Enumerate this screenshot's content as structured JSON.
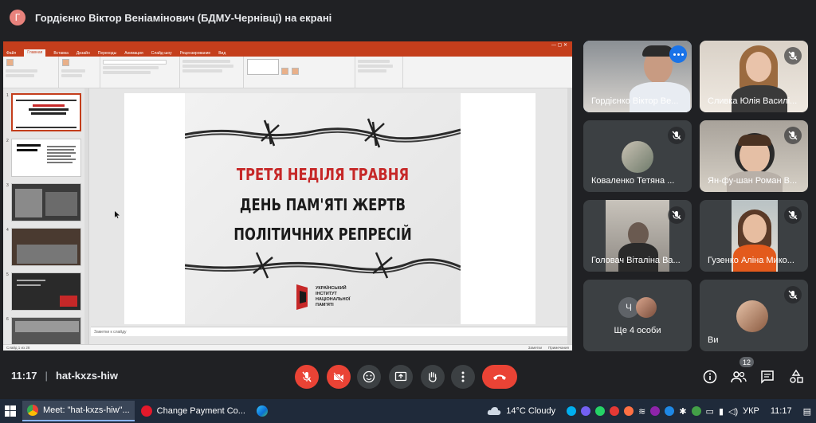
{
  "presenter": {
    "avatar_letter": "Г",
    "title": "Гордієнко Віктор Веніамінович (БДМУ-Чернівці) на екрані"
  },
  "presentation": {
    "ribbon_tabs": [
      "Файл",
      "Главная",
      "Вставка",
      "Дизайн",
      "Переходы",
      "Анимация",
      "Слайд-шоу",
      "Рецензирование",
      "Вид"
    ],
    "slide_lines": [
      "ТРЕТЯ НЕДІЛЯ ТРАВНЯ",
      "ДЕНЬ ПАМ'ЯТІ ЖЕРТВ",
      "ПОЛІТИЧНИХ РЕПРЕСІЙ"
    ],
    "institute_lines": [
      "УКРАЇНСЬКИЙ",
      "ІНСТИТУТ",
      "НАЦІОНАЛЬНОЇ",
      "ПАМ'ЯТІ"
    ],
    "notes_placeholder": "Заметки к слайду",
    "thumbnail_numbers": [
      "1",
      "2",
      "3",
      "4",
      "5",
      "6"
    ],
    "status_slide": "Слайд 1 из 28",
    "status_notes": "Заметки",
    "status_comments": "Примечания"
  },
  "participants": [
    {
      "name": "Гордієнко Віктор Ве...",
      "active": true
    },
    {
      "name": "Сливка Юлія Василі..."
    },
    {
      "name": "Коваленко Тетяна ..."
    },
    {
      "name": "Ян-фу-шан Роман В..."
    },
    {
      "name": "Головач Віталіна Ва..."
    },
    {
      "name": "Гузенко Аліна Мико..."
    }
  ],
  "others": {
    "avatar_letter": "Ч",
    "label": "Ще 4 особи"
  },
  "self_tile": {
    "name": "Ви"
  },
  "meeting": {
    "time": "11:17",
    "code": "hat-kxzs-hiw",
    "participant_count": "12"
  },
  "taskbar": {
    "items": [
      {
        "label": "Meet: \"hat-kxzs-hiw\"...",
        "active": true
      },
      {
        "label": "Change Payment Co..."
      }
    ],
    "weather": "14°C  Cloudy",
    "language": "УКР",
    "clock": "11:17"
  },
  "colors": {
    "meet_background": "#202124",
    "tile_background": "#3c4043",
    "end_call": "#ea4335",
    "active_outline": "#8ab4f8",
    "powerpoint_red": "#c43e1c",
    "slide_red_text": "#c62828"
  }
}
